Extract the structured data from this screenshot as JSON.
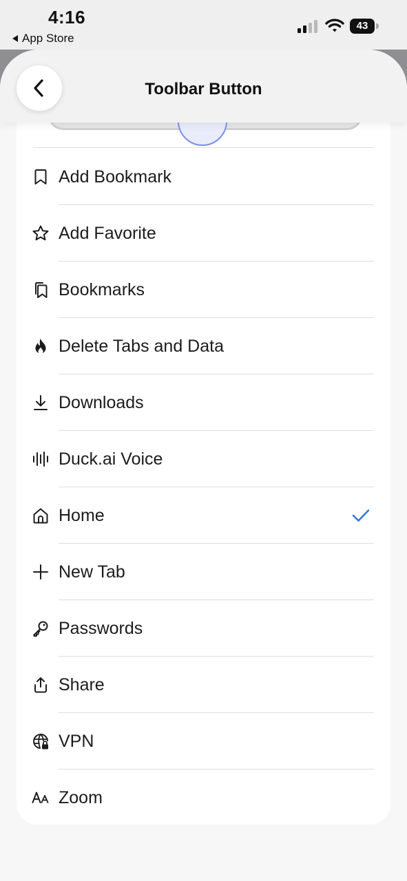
{
  "status_bar": {
    "time": "4:16",
    "back_app": "App Store",
    "battery": "43",
    "icons": [
      "signal-icon",
      "wifi-icon",
      "battery-icon"
    ]
  },
  "header": {
    "title": "Toolbar Button",
    "back_icon": "chevron-left-icon"
  },
  "options": [
    {
      "label": "Add Bookmark",
      "icon": "bookmark-icon",
      "selected": false
    },
    {
      "label": "Add Favorite",
      "icon": "star-icon",
      "selected": false
    },
    {
      "label": "Bookmarks",
      "icon": "bookmarks-icon",
      "selected": false
    },
    {
      "label": "Delete Tabs and Data",
      "icon": "fire-icon",
      "selected": false
    },
    {
      "label": "Downloads",
      "icon": "download-icon",
      "selected": false
    },
    {
      "label": "Duck.ai Voice",
      "icon": "waveform-icon",
      "selected": false
    },
    {
      "label": "Home",
      "icon": "home-icon",
      "selected": true
    },
    {
      "label": "New Tab",
      "icon": "plus-icon",
      "selected": false
    },
    {
      "label": "Passwords",
      "icon": "key-icon",
      "selected": false
    },
    {
      "label": "Share",
      "icon": "share-icon",
      "selected": false
    },
    {
      "label": "VPN",
      "icon": "vpn-globe-icon",
      "selected": false
    },
    {
      "label": "Zoom",
      "icon": "text-size-icon",
      "selected": false
    }
  ],
  "colors": {
    "accent": "#3478d9",
    "separator": "#dedede",
    "card": "#ffffff",
    "sheet": "#f7f7f7"
  }
}
